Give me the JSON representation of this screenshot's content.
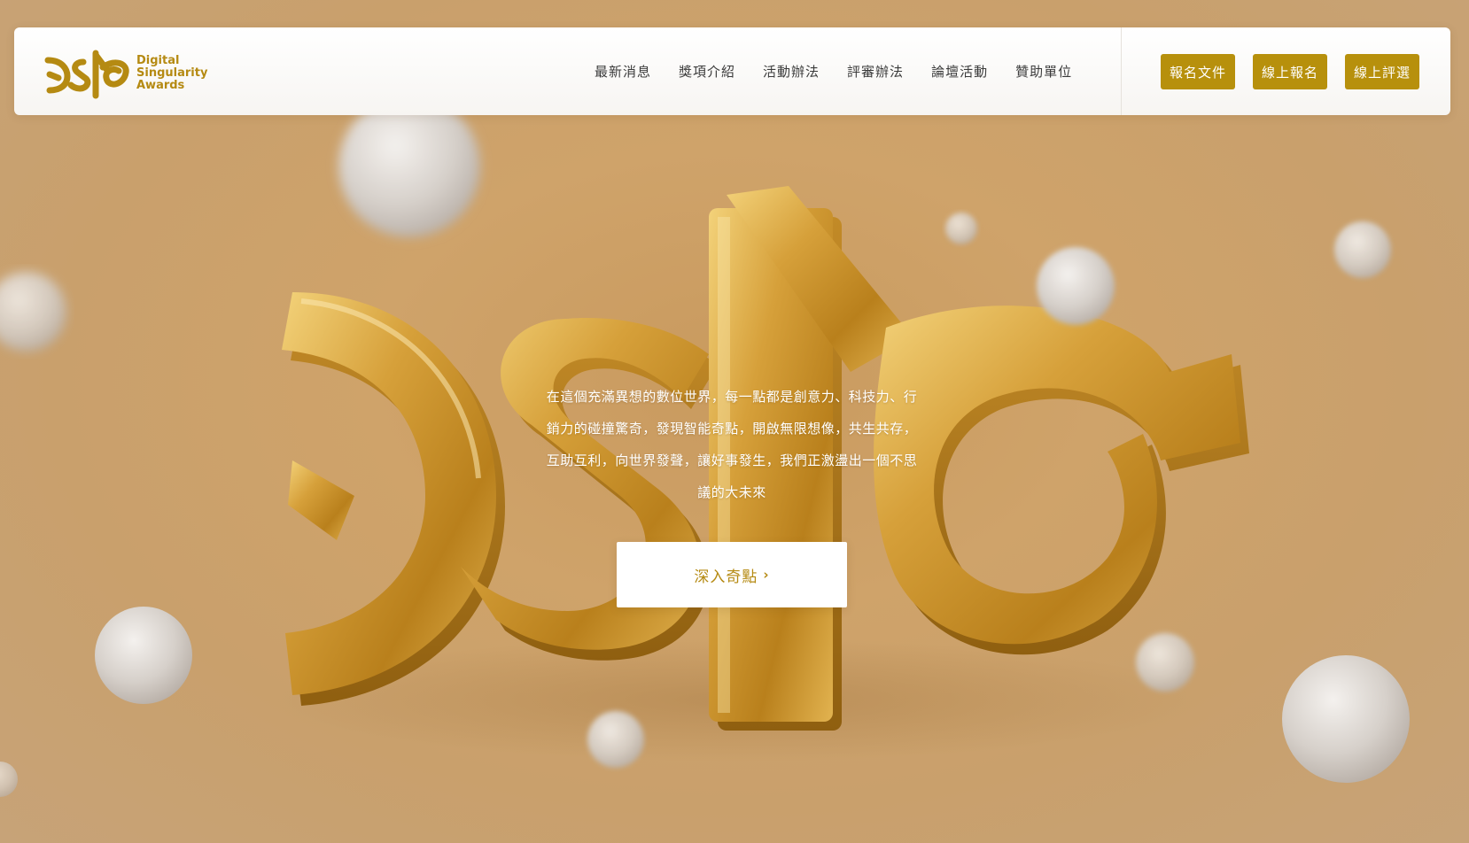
{
  "brand": {
    "name_line1": "Digital",
    "name_line2": "Singularity",
    "name_line3": "Awards",
    "color": "#b58a12"
  },
  "nav": {
    "links": [
      "最新消息",
      "獎項介紹",
      "活動辦法",
      "評審辦法",
      "論壇活動",
      "贊助單位"
    ]
  },
  "actions": {
    "docs": "報名文件",
    "register": "線上報名",
    "review": "線上評選",
    "accent": "#b7900c"
  },
  "hero": {
    "line1": "在這個充滿異想的數位世界，每一點都是創意力、科技力、行",
    "line2": "銷力的碰撞驚奇，發現智能奇點，開啟無限想像，共生共存，",
    "line3": "互助互利，向世界發聲，讓好事發生，我們正激盪出一個不思",
    "line4": "議的大未來",
    "cta_label": "深入奇點",
    "cta_icon": "chevron-right-icon",
    "logo_3d_text": "dsa"
  }
}
